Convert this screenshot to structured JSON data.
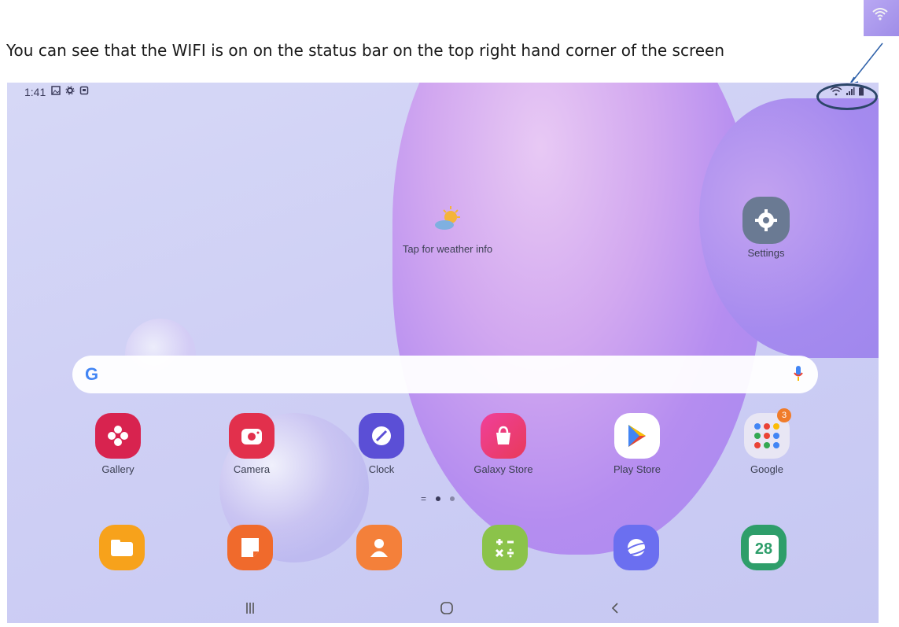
{
  "caption": "You can see that the WIFI is on on the status bar on the top right hand corner of the screen",
  "status": {
    "time": "1:41"
  },
  "weather": {
    "label": "Tap for weather info"
  },
  "settings": {
    "label": "Settings"
  },
  "apps": [
    {
      "label": "Gallery",
      "color": "#d8234f"
    },
    {
      "label": "Camera",
      "color": "#e2304c"
    },
    {
      "label": "Clock",
      "color": "#5b4fd6"
    },
    {
      "label": "Galaxy Store",
      "color": "#e83a7d"
    },
    {
      "label": "Play Store",
      "color": "#ffffff"
    },
    {
      "label": "Google",
      "color": "#e8e6f4",
      "badge": "3"
    }
  ],
  "dock": [
    {
      "icon": "folder-icon",
      "color": "#f7a21b"
    },
    {
      "icon": "notes-icon",
      "color": "#f06a2c"
    },
    {
      "icon": "contacts-icon",
      "color": "#f4803a"
    },
    {
      "icon": "calculator-icon",
      "color": "#8bc34a"
    },
    {
      "icon": "internet-icon",
      "color": "#6b6ff0"
    },
    {
      "icon": "calendar-icon",
      "color": "#2e9e6a",
      "day": "28"
    }
  ]
}
